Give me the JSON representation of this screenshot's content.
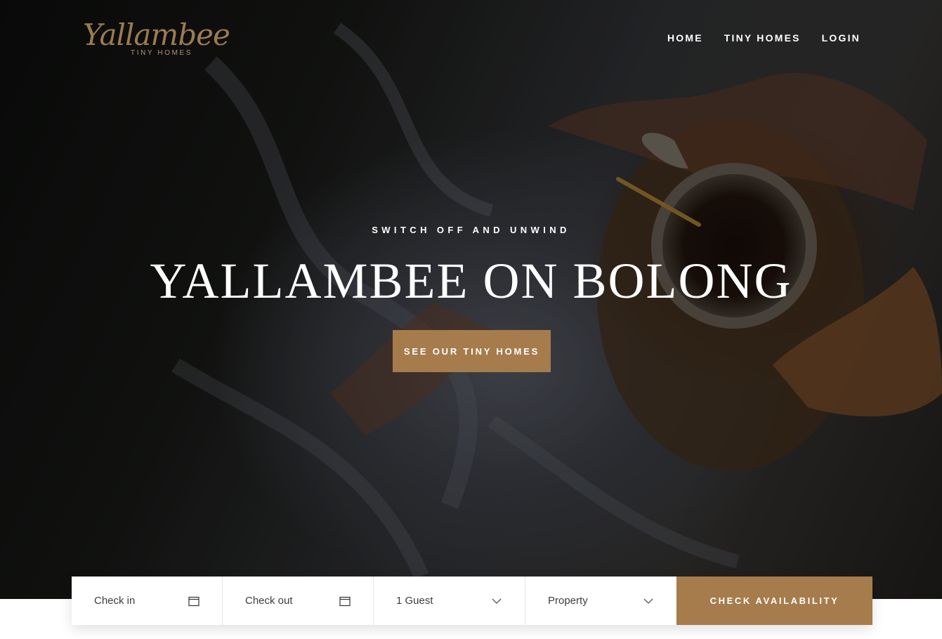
{
  "brand": {
    "logo_script": "Yallambee",
    "logo_sub": "TINY HOMES"
  },
  "nav": {
    "items": [
      "HOME",
      "TINY HOMES",
      "LOGIN"
    ]
  },
  "hero": {
    "tagline": "SWITCH OFF AND UNWIND",
    "title": "YALLAMBEE ON BOLONG",
    "cta_label": "SEE OUR TINY HOMES"
  },
  "booking": {
    "check_in": "Check in",
    "check_out": "Check out",
    "guests": "1 Guest",
    "property": "Property",
    "submit_label": "CHECK AVAILABILITY"
  },
  "colors": {
    "accent": "#a67c4c",
    "logo": "#9c7b52"
  },
  "icons": [
    "calendar-icon",
    "chevron-down-icon"
  ]
}
